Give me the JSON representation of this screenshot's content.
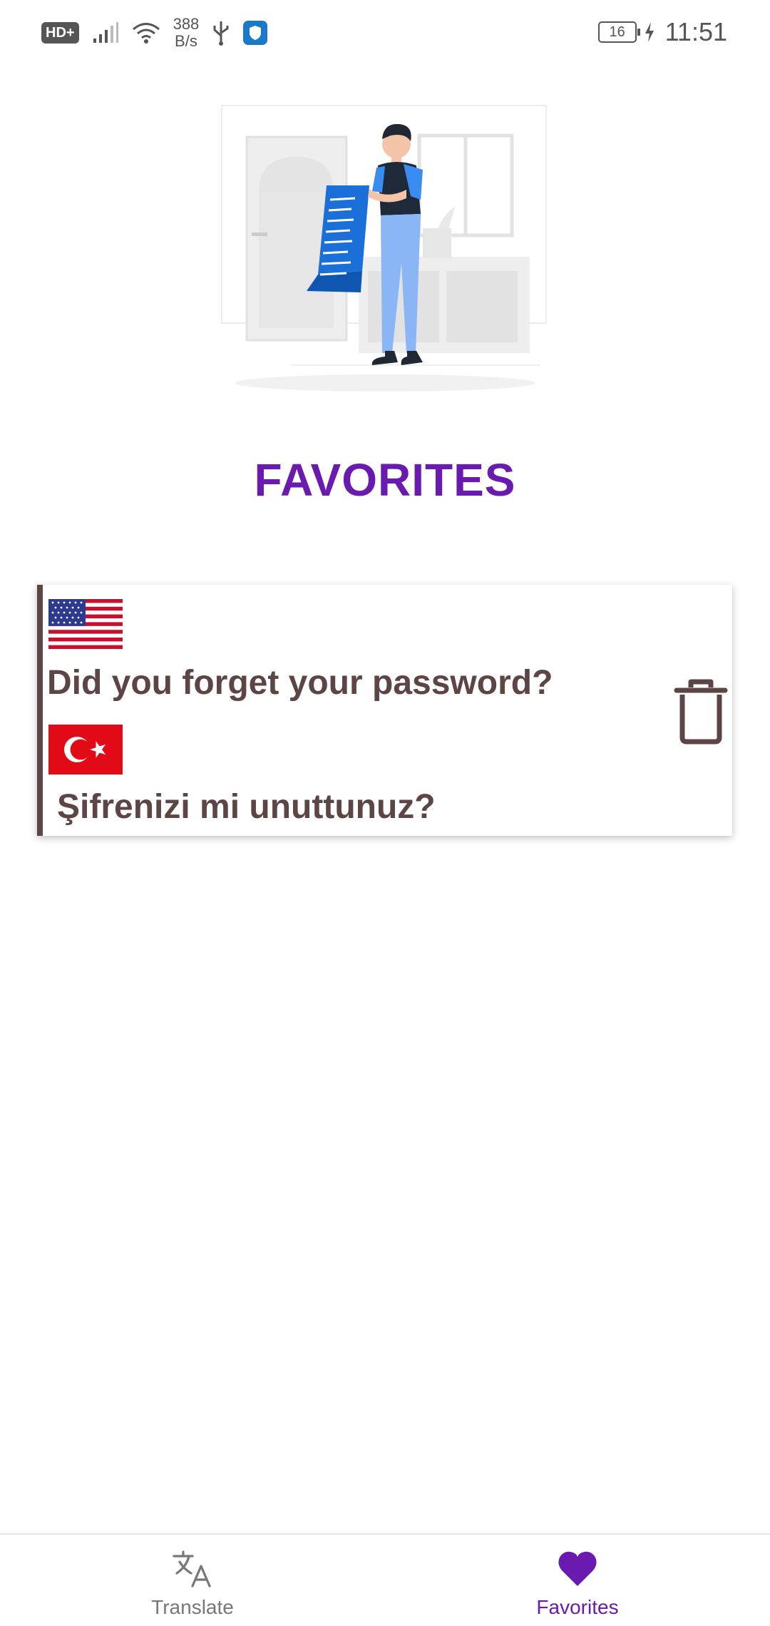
{
  "status_bar": {
    "hd_badge": "HD+",
    "net_speed_value": "388",
    "net_speed_unit": "B/s",
    "battery_level": "16",
    "time": "11:51"
  },
  "header": {
    "title": "FAVORITES"
  },
  "favorites": [
    {
      "source_flag": "us-flag-icon",
      "source_text": "Did you forget your password?",
      "target_flag": "tr-flag-icon",
      "target_text": "Şifrenizi mi unuttunuz?"
    }
  ],
  "bottom_nav": {
    "translate_label": "Translate",
    "favorites_label": "Favorites",
    "active_tab": "Favorites"
  },
  "colors": {
    "accent": "#6a1aae",
    "text_brown": "#5d4545",
    "inactive": "#777777"
  }
}
